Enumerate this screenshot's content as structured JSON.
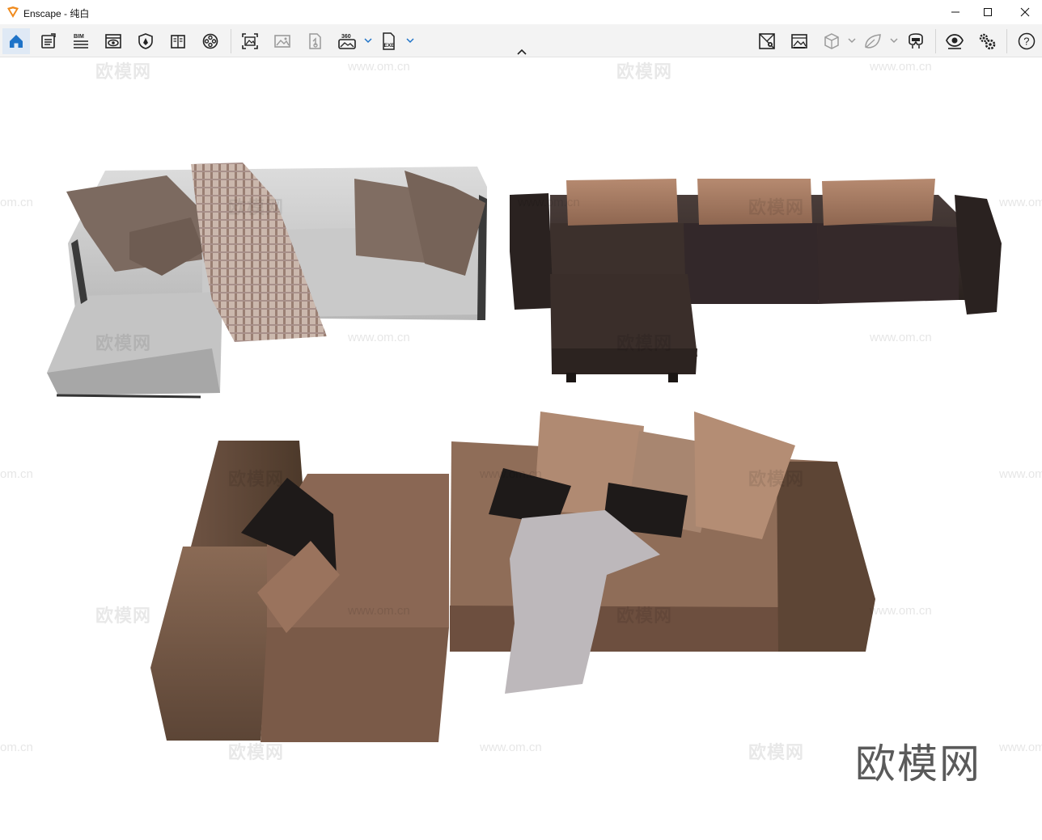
{
  "window": {
    "title": "Enscape - 纯白",
    "controls": [
      "minimize",
      "maximize",
      "close"
    ]
  },
  "toolbar": {
    "left_icons": [
      "home-icon",
      "clipboard-icon",
      "bim-icon",
      "eye-icon",
      "shield-icon",
      "book-icon",
      "film-reel-icon"
    ],
    "bim_label": "BIM",
    "render_icons": [
      "screenshot-icon",
      "image-icon",
      "batch-render-icon",
      "panorama-360-icon",
      "export-exe-icon"
    ],
    "pano_label": "360",
    "exe_label": "EXE",
    "right_icons": [
      "site-context-icon",
      "image-gallery-icon",
      "cube-icon",
      "material-leaf-icon",
      "vr-headset-icon",
      "visual-settings-icon",
      "settings-gears-icon",
      "help-icon"
    ]
  },
  "watermarks": {
    "site": "www.om.cn",
    "site_cut": "om.cn",
    "brand": "欧模网",
    "logo": "欧模网"
  },
  "colors": {
    "accent_blue": "#1e73c8",
    "orange_logo": "#f08a1c",
    "icon_gray": "#222222",
    "disabled_gray": "#9a9a9a"
  }
}
